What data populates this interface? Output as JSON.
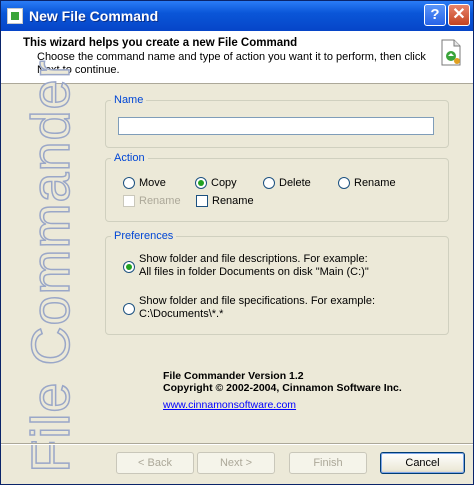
{
  "window": {
    "title": "New File Command"
  },
  "header": {
    "title": "This wizard helps you create a new File Command",
    "description": "Choose the command name and type of action you want it to perform, then click Next to continue."
  },
  "side_banner": "File Commander",
  "name_group": {
    "legend": "Name",
    "value": "",
    "placeholder": ""
  },
  "action_group": {
    "legend": "Action",
    "radios": [
      {
        "label": "Move",
        "checked": false
      },
      {
        "label": "Copy",
        "checked": true
      },
      {
        "label": "Delete",
        "checked": false
      },
      {
        "label": "Rename",
        "checked": false
      }
    ],
    "checkboxes": [
      {
        "label": "Rename",
        "enabled": false,
        "checked": false
      },
      {
        "label": "Rename",
        "enabled": true,
        "checked": false
      }
    ]
  },
  "preferences_group": {
    "legend": "Preferences",
    "options": [
      {
        "line1": "Show folder and file descriptions.  For example:",
        "line2": "All files in folder Documents on disk \"Main (C:)\"",
        "checked": true
      },
      {
        "line1": "Show folder and file specifications.  For example:",
        "line2": "C:\\Documents\\*.*",
        "checked": false
      }
    ]
  },
  "about": {
    "version": "File Commander Version 1.2",
    "copyright": "Copyright © 2002-2004, Cinnamon Software Inc.",
    "link": "www.cinnamonsoftware.com"
  },
  "buttons": {
    "back": "< Back",
    "next": "Next >",
    "finish": "Finish",
    "cancel": "Cancel"
  },
  "colors": {
    "accent": "#0046d5",
    "titlebar": "#0a56d8",
    "radio_dot": "#21a121"
  }
}
